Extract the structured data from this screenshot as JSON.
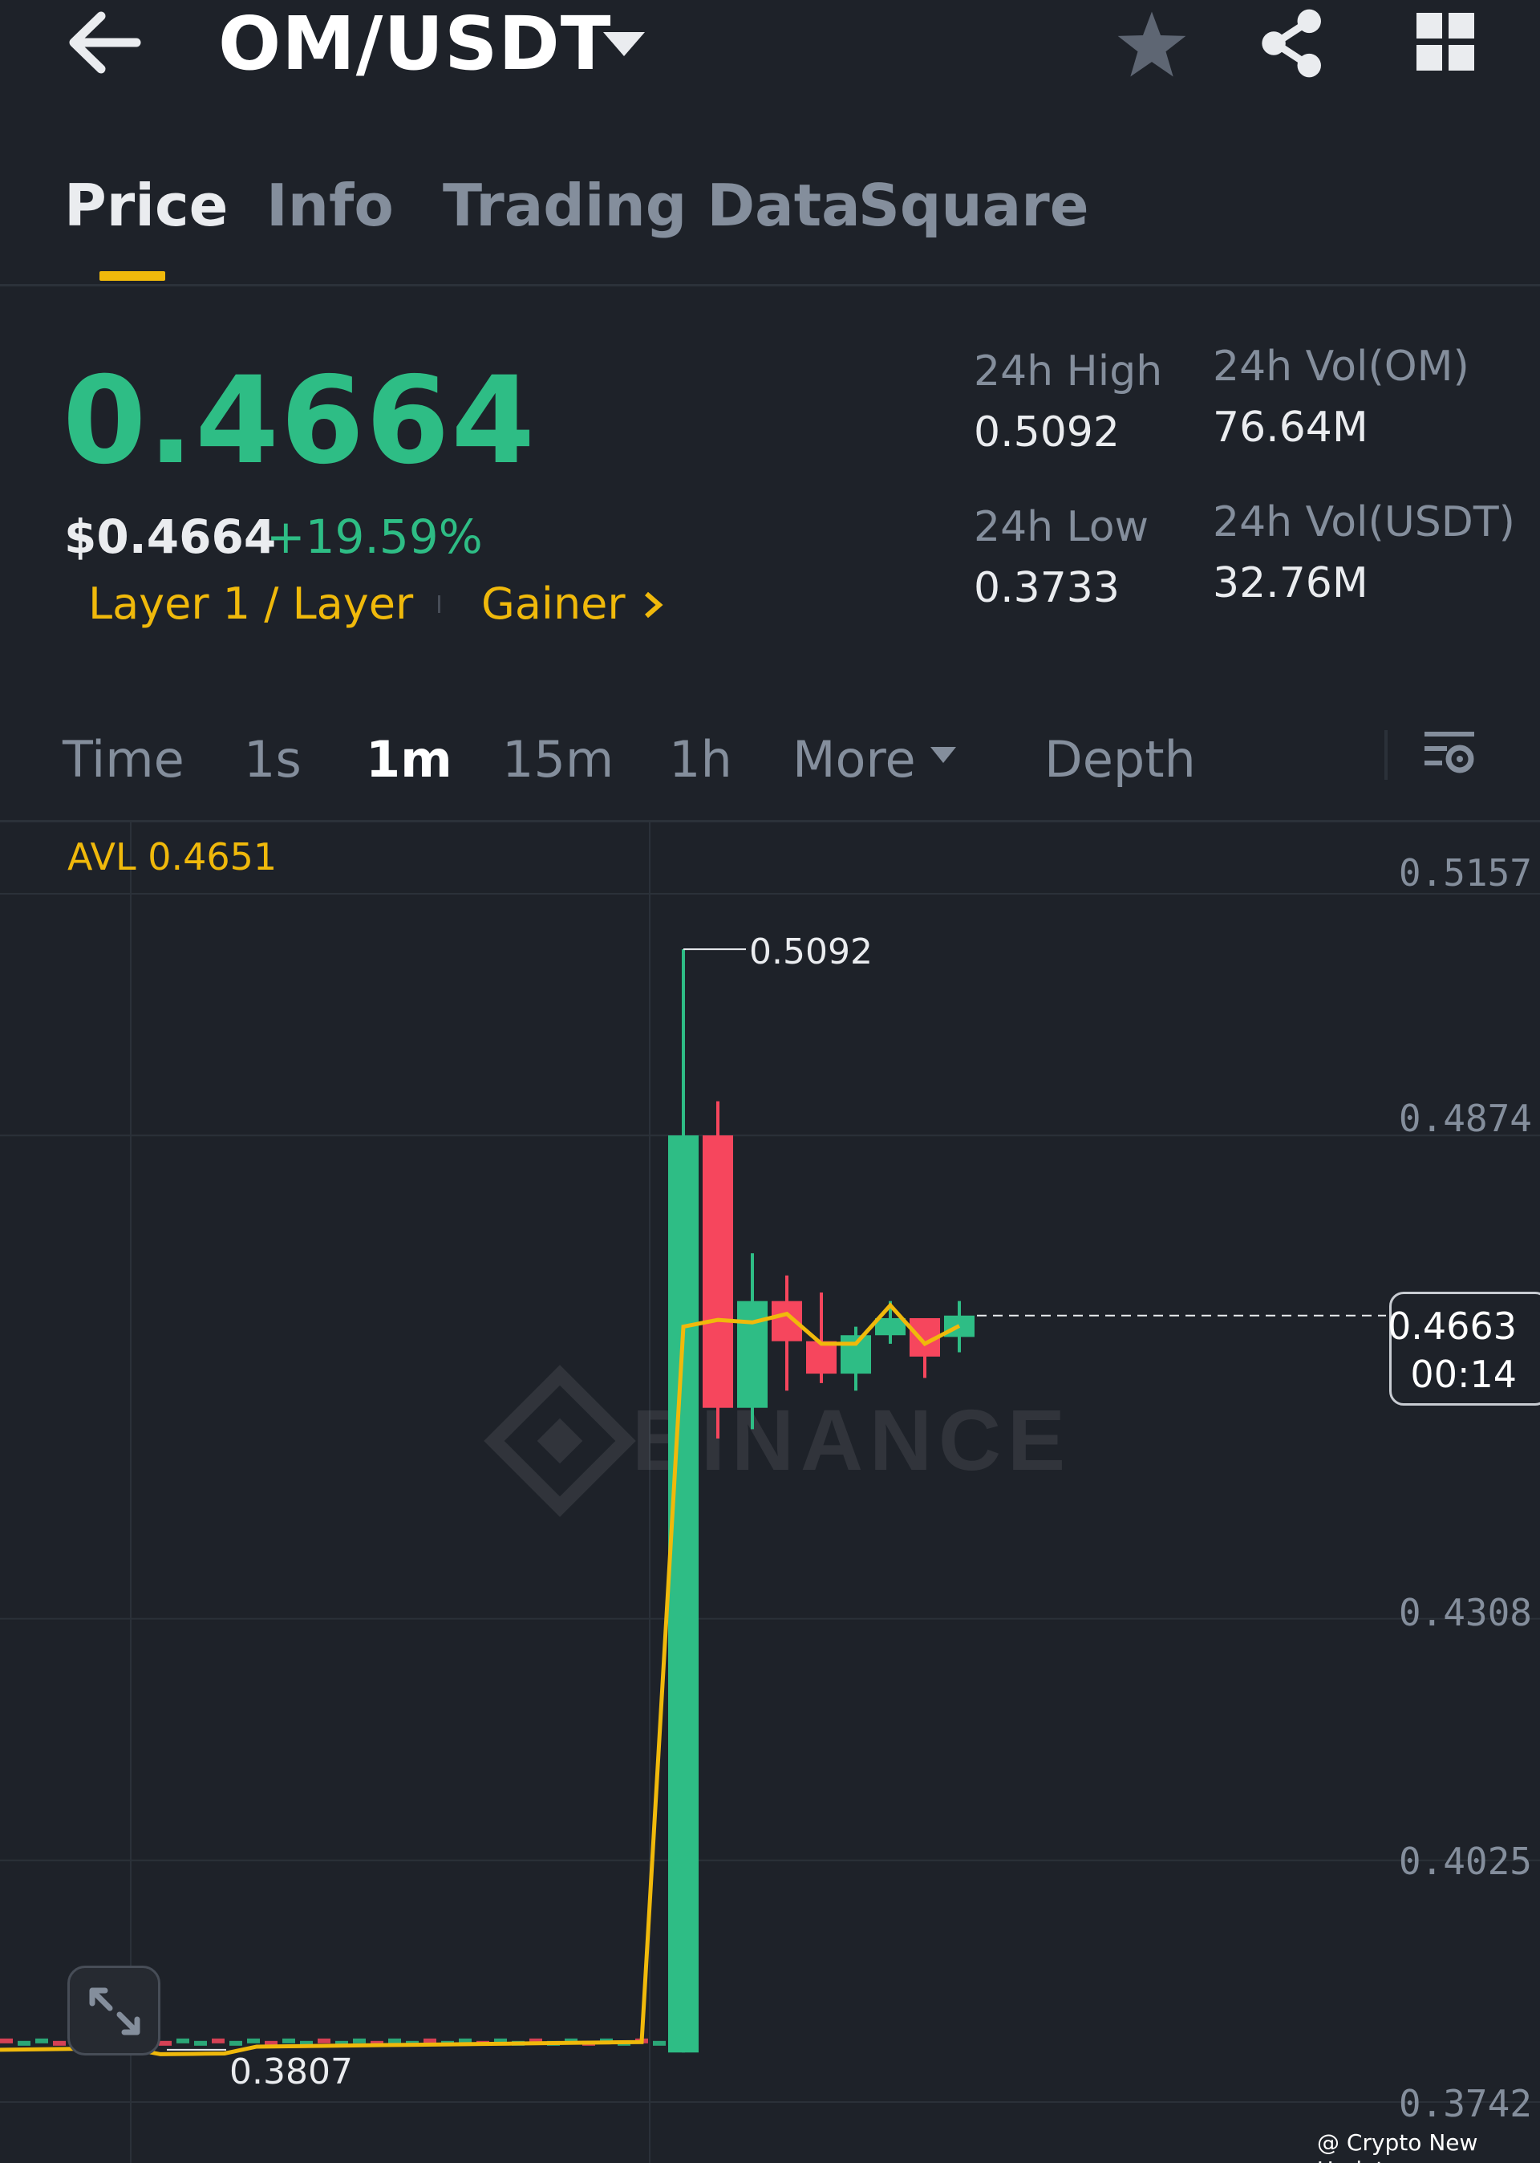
{
  "header": {
    "pair": "OM/USDT",
    "icons": [
      "back-arrow-icon",
      "caret-down-icon",
      "star-icon",
      "share-icon",
      "grid-icon"
    ]
  },
  "tabs": [
    {
      "label": "Price",
      "active": true
    },
    {
      "label": "Info",
      "active": false
    },
    {
      "label": "Trading Data",
      "active": false
    },
    {
      "label": "Square",
      "active": false
    }
  ],
  "price": {
    "last": "0.4664",
    "usd": "$0.4664",
    "change_pct": "+19.59%",
    "tag_category": "Layer 1 / Layer",
    "tag_gainer": "Gainer",
    "high_label": "24h High",
    "high_value": "0.5092",
    "low_label": "24h Low",
    "low_value": "0.3733",
    "vol_base_label": "24h Vol(OM)",
    "vol_base_value": "76.64M",
    "vol_quote_label": "24h Vol(USDT)",
    "vol_quote_value": "32.76M"
  },
  "intervals": [
    {
      "label": "Time",
      "active": false
    },
    {
      "label": "1s",
      "active": false
    },
    {
      "label": "1m",
      "active": true
    },
    {
      "label": "15m",
      "active": false
    },
    {
      "label": "1h",
      "active": false
    },
    {
      "label": "More",
      "active": false
    },
    {
      "label": "Depth",
      "active": false
    }
  ],
  "chart": {
    "avl_label": "AVL 0.4651",
    "y_ticks": [
      "0.5157",
      "0.4874",
      "0.4308",
      "0.4025",
      "0.3742"
    ],
    "high_annotation": "0.5092",
    "low_annotation": "0.3807",
    "current_price": "0.4663",
    "countdown": "00:14",
    "watermark": "BINANCE"
  },
  "chart_data": {
    "type": "candlestick",
    "y_axis_ticks": [
      0.5157,
      0.4874,
      0.4308,
      0.4025,
      0.3742
    ],
    "ylim": [
      0.3742,
      0.5157
    ],
    "candles": [
      {
        "open": 0.38,
        "high": 0.5092,
        "low": 0.38,
        "close": 0.4874,
        "dir": "up"
      },
      {
        "open": 0.4874,
        "high": 0.4914,
        "low": 0.4519,
        "close": 0.4555,
        "dir": "down"
      },
      {
        "open": 0.4555,
        "high": 0.4736,
        "low": 0.453,
        "close": 0.468,
        "dir": "up"
      },
      {
        "open": 0.468,
        "high": 0.471,
        "low": 0.4575,
        "close": 0.4633,
        "dir": "down"
      },
      {
        "open": 0.4633,
        "high": 0.469,
        "low": 0.4584,
        "close": 0.4595,
        "dir": "down"
      },
      {
        "open": 0.4595,
        "high": 0.465,
        "low": 0.4575,
        "close": 0.464,
        "dir": "up"
      },
      {
        "open": 0.464,
        "high": 0.468,
        "low": 0.463,
        "close": 0.466,
        "dir": "up"
      },
      {
        "open": 0.466,
        "high": 0.466,
        "low": 0.459,
        "close": 0.4615,
        "dir": "down"
      },
      {
        "open": 0.4638,
        "high": 0.468,
        "low": 0.462,
        "close": 0.4663,
        "dir": "up"
      }
    ],
    "flat_price": 0.3807,
    "avl_line": [
      0.3807,
      0.465,
      0.4658,
      0.4655,
      0.4665,
      0.463,
      0.463,
      0.4675,
      0.463,
      0.4651
    ],
    "current_price": 0.4663,
    "high": 0.5092,
    "low": 0.3807
  },
  "watermark": "@ Crypto New Updates"
}
